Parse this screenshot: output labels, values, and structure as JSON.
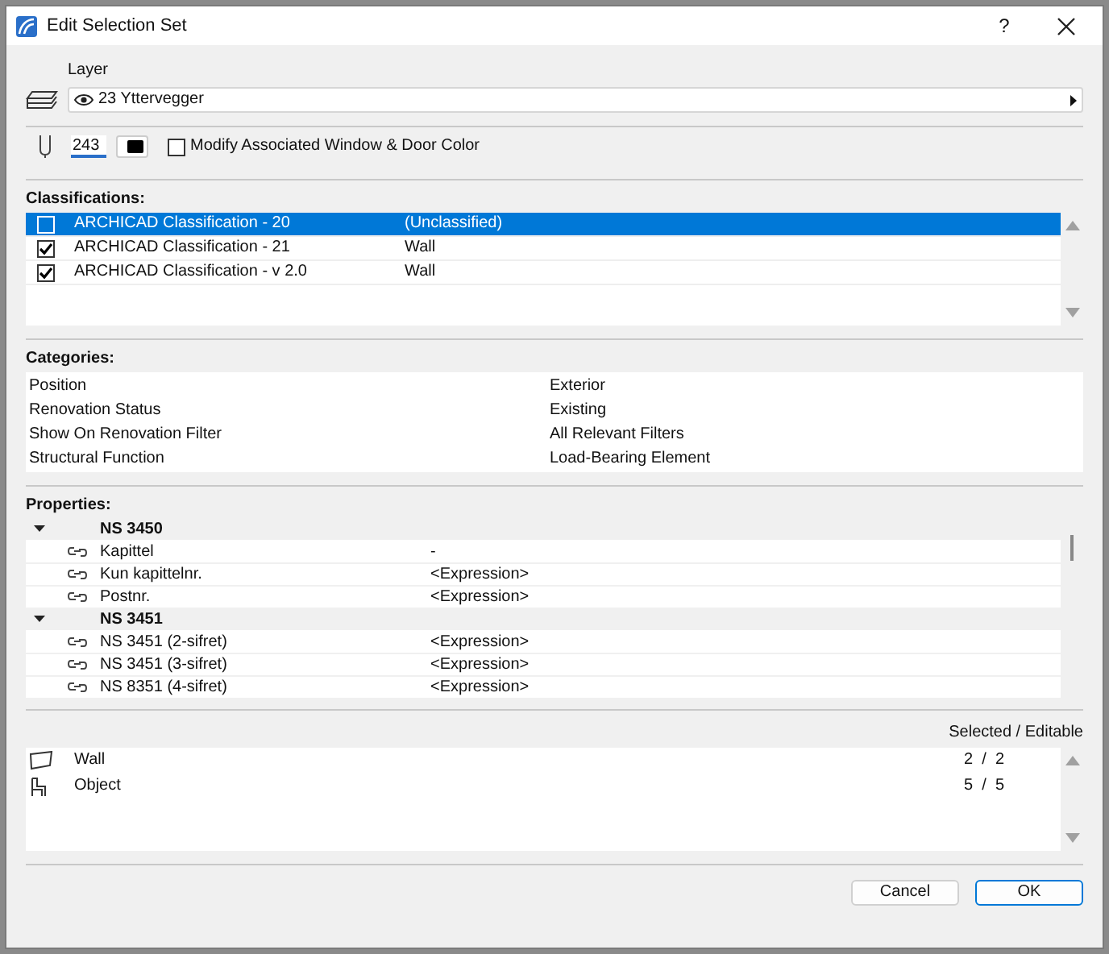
{
  "window": {
    "title": "Edit Selection Set",
    "help": "?"
  },
  "layer": {
    "label": "Layer",
    "value": "23 Yttervegger"
  },
  "pen": {
    "value": "243",
    "modify_color": {
      "label": "Modify Associated Window & Door Color",
      "checked": false
    }
  },
  "classifications": {
    "heading": "Classifications:",
    "rows": [
      {
        "name": "ARCHICAD Classification - 20",
        "value": "(Unclassified)",
        "checked": false,
        "selected": true
      },
      {
        "name": "ARCHICAD Classification - 21",
        "value": "Wall",
        "checked": true,
        "selected": false
      },
      {
        "name": "ARCHICAD Classification - v 2.0",
        "value": "Wall",
        "checked": true,
        "selected": false
      }
    ]
  },
  "categories": {
    "heading": "Categories:",
    "rows": [
      {
        "name": "Position",
        "value": "Exterior"
      },
      {
        "name": "Renovation Status",
        "value": "Existing"
      },
      {
        "name": "Show On Renovation Filter",
        "value": "All Relevant Filters"
      },
      {
        "name": "Structural Function",
        "value": "Load-Bearing Element"
      }
    ]
  },
  "properties": {
    "heading": "Properties:",
    "groups": [
      {
        "name": "NS 3450",
        "expanded": true,
        "children": [
          {
            "name": "Kapittel",
            "value": "-"
          },
          {
            "name": "Kun kapittelnr.",
            "value": "<Expression>"
          },
          {
            "name": "Postnr.",
            "value": "<Expression>"
          }
        ]
      },
      {
        "name": "NS 3451",
        "expanded": true,
        "children": [
          {
            "name": "NS 3451 (2-sifret)",
            "value": "<Expression>"
          },
          {
            "name": "NS 3451 (3-sifret)",
            "value": "<Expression>"
          },
          {
            "name": "NS 8351 (4-sifret)",
            "value": "<Expression>"
          }
        ]
      }
    ]
  },
  "elements": {
    "header": "Selected / Editable",
    "rows": [
      {
        "kind": "wall",
        "name": "Wall",
        "count": "2  /  2"
      },
      {
        "kind": "object",
        "name": "Object",
        "count": "5  /  5"
      }
    ]
  },
  "buttons": [
    {
      "label": "Cancel",
      "default": false
    },
    {
      "label": "OK",
      "default": true
    }
  ]
}
